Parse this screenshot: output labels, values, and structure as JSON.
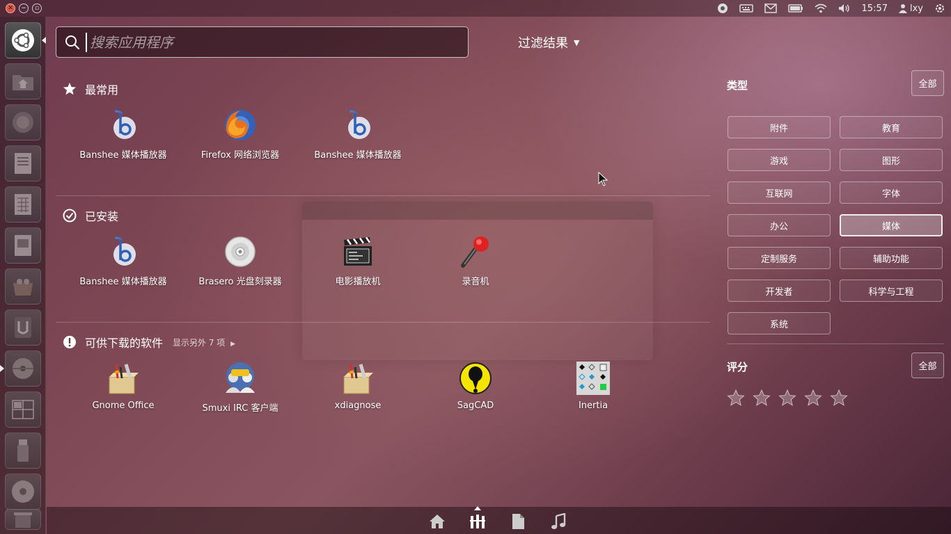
{
  "top_panel": {
    "clock": "15:57",
    "user": "lxy"
  },
  "search": {
    "placeholder": "搜索应用程序"
  },
  "filter_toggle": {
    "label": "过滤结果",
    "caret": "▼"
  },
  "sections": {
    "most_used": {
      "title": "最常用",
      "apps": [
        {
          "label": "Banshee 媒体播放器",
          "icon": "banshee-icon"
        },
        {
          "label": "Firefox 网络浏览器",
          "icon": "firefox-icon"
        },
        {
          "label": "Banshee 媒体播放器",
          "icon": "banshee-icon"
        }
      ]
    },
    "installed": {
      "title": "已安装",
      "apps": [
        {
          "label": "Banshee 媒体播放器",
          "icon": "banshee-icon"
        },
        {
          "label": "Brasero 光盘刻录器",
          "icon": "brasero-icon"
        },
        {
          "label": "电影播放机",
          "icon": "clapperboard-icon"
        },
        {
          "label": "录音机",
          "icon": "microphone-icon"
        }
      ]
    },
    "available": {
      "title": "可供下载的软件",
      "more": "显示另外 7 项",
      "apps": [
        {
          "label": "Gnome Office",
          "icon": "gnome-office-icon"
        },
        {
          "label": "Smuxi IRC 客户端",
          "icon": "smuxi-icon"
        },
        {
          "label": "xdiagnose",
          "icon": "xdiagnose-icon"
        },
        {
          "label": "SagCAD",
          "icon": "sagcad-icon"
        },
        {
          "label": "Inertia",
          "icon": "inertia-icon"
        }
      ]
    }
  },
  "filters": {
    "type_heading": "类型",
    "all_label": "全部",
    "categories": [
      "附件",
      "教育",
      "游戏",
      "图形",
      "互联网",
      "字体",
      "办公",
      "媒体",
      "定制服务",
      "辅助功能",
      "开发者",
      "科学与工程",
      "系统"
    ],
    "selected_category": "媒体",
    "rating_heading": "评分",
    "rating_all_label": "全部",
    "rating_stars": 5
  },
  "lenses": [
    "home-icon",
    "applications-icon",
    "files-icon",
    "music-icon"
  ],
  "active_lens": "applications-icon"
}
